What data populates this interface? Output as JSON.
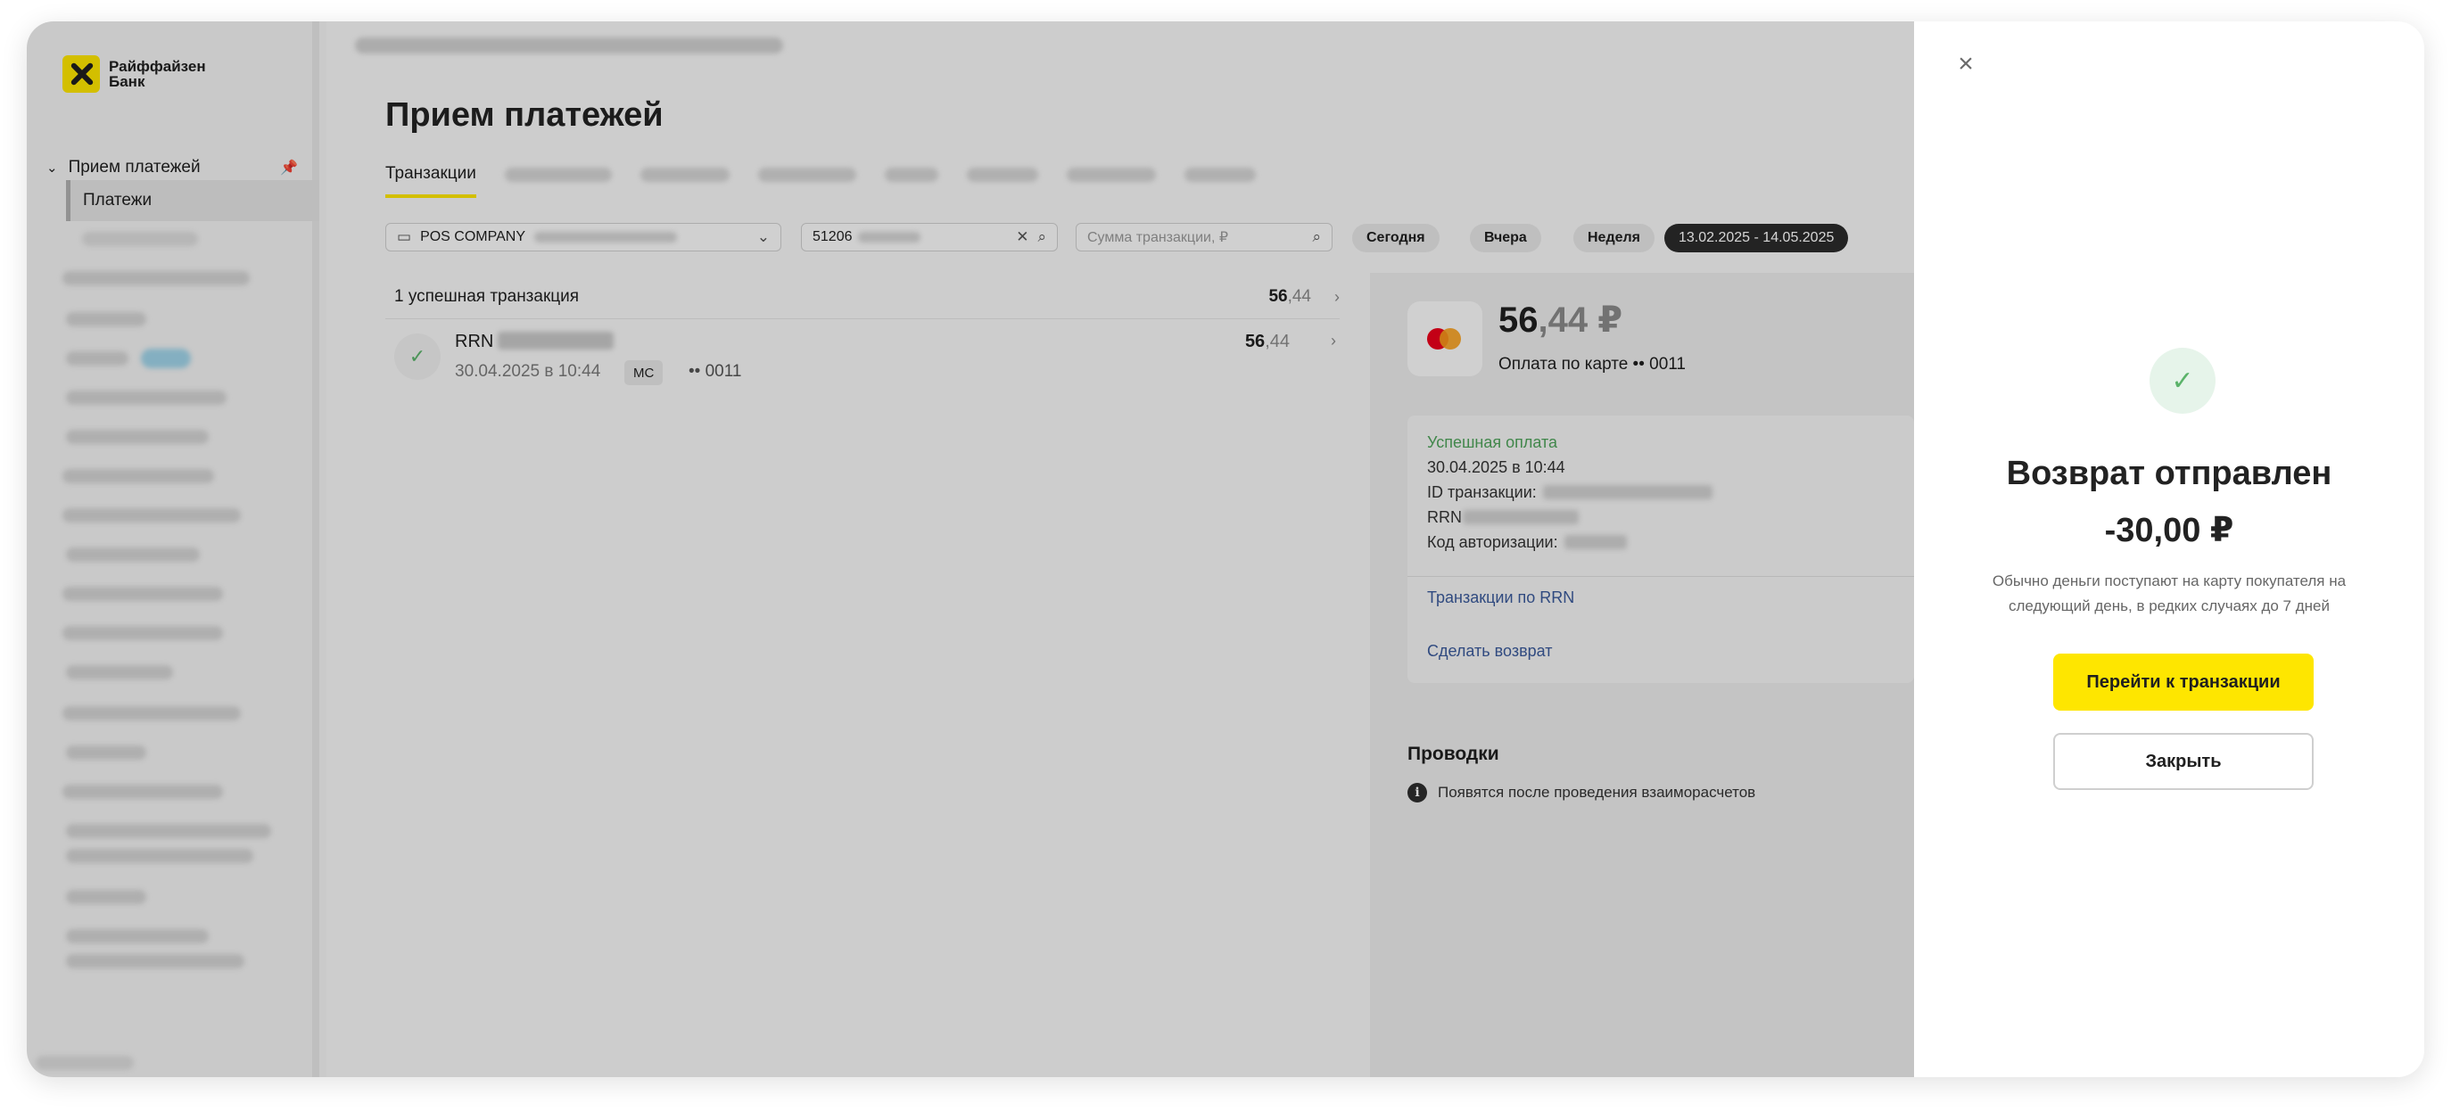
{
  "bank": {
    "logo_text": "Райффайзен Банк"
  },
  "sidebar": {
    "section_label": "Прием платежей",
    "active_item": "Платежи"
  },
  "main": {
    "title": "Прием платежей",
    "active_tab": "Транзакции",
    "filters": {
      "terminal_value": "POS COMPANY",
      "card_search_value": "51206",
      "amount_placeholder": "Сумма транзакции, ₽",
      "chips": [
        "Сегодня",
        "Вчера",
        "Неделя"
      ],
      "date_range": "13.02.2025 - 14.05.2025"
    },
    "summary": {
      "label": "1 успешная транзакция",
      "amount_int": "56",
      "amount_cents": ",44"
    },
    "transaction": {
      "rrn_label": "RRN",
      "datetime": "30.04.2025 в 10:44",
      "card_type": "MC",
      "card_mask": "•• 0011",
      "amount_int": "56",
      "amount_cents": ",44"
    }
  },
  "detail": {
    "amount_int": "56",
    "amount_cents": ",44 ₽",
    "pay_method": "Оплата по карте •• 0011",
    "status": "Успешная оплата",
    "datetime": "30.04.2025 в 10:44",
    "id_label": "ID транзакции:",
    "rrn_label": "RRN",
    "auth_label": "Код авторизации:",
    "link_rrn": "Транзакции по RRN",
    "link_refund": "Сделать возврат",
    "postings_title": "Проводки",
    "postings_note": "Появятся после проведения взаиморасчетов"
  },
  "modal": {
    "title": "Возврат отправлен",
    "amount": "-30,00 ₽",
    "description": "Обычно деньги поступают на карту покупателя на следующий день, в редких случаях до 7 дней",
    "primary_button": "Перейти к транзакции",
    "secondary_button": "Закрыть"
  },
  "icons": {
    "close": "close-icon",
    "check": "check-icon",
    "info": "info-icon",
    "search": "search-icon",
    "clear": "clear-icon",
    "chevron": "chevron-down-icon",
    "pin": "pin-icon"
  },
  "colors": {
    "brand_yellow": "#fee600",
    "success_green": "#5bb36a",
    "link_blue": "#3a5a9a",
    "dark_pill": "#2b2b2b"
  }
}
